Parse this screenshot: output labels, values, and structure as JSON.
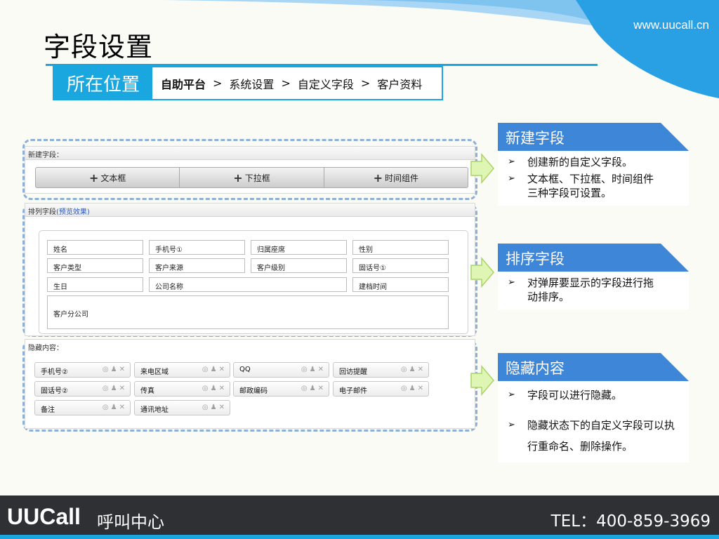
{
  "header": {
    "site_url": "www.uucall.cn",
    "page_title": "字段设置"
  },
  "location": {
    "label": "所在位置",
    "path": [
      "自助平台",
      "系统设置",
      "自定义字段",
      "客户资料"
    ],
    "separator": ">"
  },
  "new_field_panel": {
    "heading": "新建字段：",
    "buttons": [
      "文本框",
      "下拉框",
      "时间组件"
    ]
  },
  "sort_panel": {
    "heading": "排列字段",
    "preview_link": "(预览效果)",
    "fields": [
      "姓名",
      "手机号①",
      "归属座席",
      "性别",
      "客户类型",
      "客户来源",
      "客户级别",
      "固话号①",
      "生日",
      "公司名称",
      "建档时间",
      "客户分公司"
    ]
  },
  "hidden_panel": {
    "heading": "隐藏内容：",
    "fields": [
      "手机号②",
      "来电区域",
      "QQ",
      "回访提醒",
      "固话号②",
      "传真",
      "邮政编码",
      "电子邮件",
      "备注",
      "通讯地址"
    ]
  },
  "info_blocks": [
    {
      "title": "新建字段",
      "items": [
        "创建新的自定义字段。",
        "文本框、下拉框、时间组件三种字段可设置。"
      ]
    },
    {
      "title": "排序字段",
      "items": [
        "对弹屏要显示的字段进行拖动排序。"
      ]
    },
    {
      "title": "隐藏内容",
      "items": [
        "字段可以进行隐藏。",
        "隐藏状态下的自定义字段可以执行重命名、删除操作。"
      ]
    }
  ],
  "footer": {
    "brand": "UUCall",
    "brand_sub": "呼叫中心",
    "tel": "TEL：400-859-3969"
  },
  "colors": {
    "accent": "#1aa7e0",
    "heading_blue": "#3d86d8",
    "footer_bg": "#2f3033",
    "dash_border": "#8eb0d6",
    "arrow_green": "#d6f2a8"
  }
}
